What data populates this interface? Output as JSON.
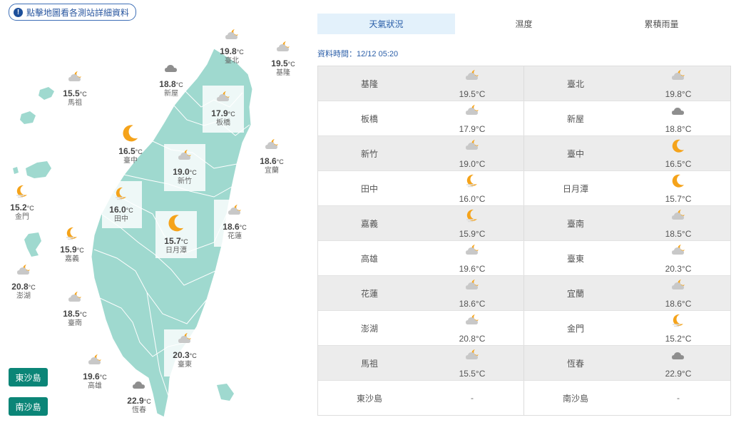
{
  "hint": {
    "icon": "info-icon",
    "text": "點擊地圖看各測站詳細資料"
  },
  "tabs": [
    {
      "label": "天氣狀況",
      "active": true
    },
    {
      "label": "濕度",
      "active": false
    },
    {
      "label": "累積雨量",
      "active": false
    }
  ],
  "update_time": "資料時間：12/12 05:20",
  "unit": "°C",
  "buttons": {
    "dongsha": "東沙島",
    "nansha": "南沙島"
  },
  "map_stations": [
    {
      "id": "taipei",
      "name": "臺北",
      "temp": "19.8",
      "icon": "partly-cloudy-night-icon"
    },
    {
      "id": "keelung",
      "name": "基隆",
      "temp": "19.5",
      "icon": "partly-cloudy-night-icon"
    },
    {
      "id": "xinwu",
      "name": "新屋",
      "temp": "18.8",
      "icon": "cloudy-icon"
    },
    {
      "id": "banqiao",
      "name": "板橋",
      "temp": "17.9",
      "icon": "partly-cloudy-night-icon"
    },
    {
      "id": "matsu",
      "name": "馬祖",
      "temp": "15.5",
      "icon": "partly-cloudy-night-icon"
    },
    {
      "id": "taichung",
      "name": "臺中",
      "temp": "16.5",
      "icon": "moon-icon"
    },
    {
      "id": "hsinchu",
      "name": "新竹",
      "temp": "19.0",
      "icon": "partly-cloudy-night-icon"
    },
    {
      "id": "yilan",
      "name": "宜蘭",
      "temp": "18.6",
      "icon": "partly-cloudy-night-icon"
    },
    {
      "id": "kinmen",
      "name": "金門",
      "temp": "15.2",
      "icon": "moon-cloud-icon"
    },
    {
      "id": "tianzhong",
      "name": "田中",
      "temp": "16.0",
      "icon": "moon-cloud-icon"
    },
    {
      "id": "riyuetan",
      "name": "日月潭",
      "temp": "15.7",
      "icon": "moon-icon"
    },
    {
      "id": "hualien",
      "name": "花蓮",
      "temp": "18.6",
      "icon": "partly-cloudy-night-icon"
    },
    {
      "id": "chiayi",
      "name": "嘉義",
      "temp": "15.9",
      "icon": "moon-cloud-icon"
    },
    {
      "id": "penghu",
      "name": "澎湖",
      "temp": "20.8",
      "icon": "partly-cloudy-night-icon"
    },
    {
      "id": "tainan",
      "name": "臺南",
      "temp": "18.5",
      "icon": "partly-cloudy-night-icon"
    },
    {
      "id": "taitung",
      "name": "臺東",
      "temp": "20.3",
      "icon": "partly-cloudy-night-icon"
    },
    {
      "id": "kaohsiung",
      "name": "高雄",
      "temp": "19.6",
      "icon": "partly-cloudy-night-icon"
    },
    {
      "id": "hengchun",
      "name": "恆春",
      "temp": "22.9",
      "icon": "cloudy-icon"
    }
  ],
  "table_rows": [
    [
      {
        "name": "基隆",
        "temp": "19.5°C",
        "icon": "partly-cloudy-night-icon"
      },
      {
        "name": "臺北",
        "temp": "19.8°C",
        "icon": "partly-cloudy-night-icon"
      }
    ],
    [
      {
        "name": "板橋",
        "temp": "17.9°C",
        "icon": "partly-cloudy-night-icon"
      },
      {
        "name": "新屋",
        "temp": "18.8°C",
        "icon": "cloudy-icon"
      }
    ],
    [
      {
        "name": "新竹",
        "temp": "19.0°C",
        "icon": "partly-cloudy-night-icon"
      },
      {
        "name": "臺中",
        "temp": "16.5°C",
        "icon": "moon-icon"
      }
    ],
    [
      {
        "name": "田中",
        "temp": "16.0°C",
        "icon": "moon-cloud-icon"
      },
      {
        "name": "日月潭",
        "temp": "15.7°C",
        "icon": "moon-icon"
      }
    ],
    [
      {
        "name": "嘉義",
        "temp": "15.9°C",
        "icon": "moon-cloud-icon"
      },
      {
        "name": "臺南",
        "temp": "18.5°C",
        "icon": "partly-cloudy-night-icon"
      }
    ],
    [
      {
        "name": "高雄",
        "temp": "19.6°C",
        "icon": "partly-cloudy-night-icon"
      },
      {
        "name": "臺東",
        "temp": "20.3°C",
        "icon": "partly-cloudy-night-icon"
      }
    ],
    [
      {
        "name": "花蓮",
        "temp": "18.6°C",
        "icon": "partly-cloudy-night-icon"
      },
      {
        "name": "宜蘭",
        "temp": "18.6°C",
        "icon": "partly-cloudy-night-icon"
      }
    ],
    [
      {
        "name": "澎湖",
        "temp": "20.8°C",
        "icon": "partly-cloudy-night-icon"
      },
      {
        "name": "金門",
        "temp": "15.2°C",
        "icon": "moon-cloud-icon"
      }
    ],
    [
      {
        "name": "馬祖",
        "temp": "15.5°C",
        "icon": "partly-cloudy-night-icon"
      },
      {
        "name": "恆春",
        "temp": "22.9°C",
        "icon": "cloudy-icon"
      }
    ],
    [
      {
        "name": "東沙島",
        "temp": "-",
        "icon": ""
      },
      {
        "name": "南沙島",
        "temp": "-",
        "icon": ""
      }
    ]
  ],
  "colors": {
    "land": "#9fd9cf",
    "border": "#ffffff",
    "accent": "#2a5ea8",
    "button": "#0b8577",
    "moon": "#f5a31a",
    "cloud": "#c8c8c8",
    "cloud_dark": "#8e8e8e"
  }
}
